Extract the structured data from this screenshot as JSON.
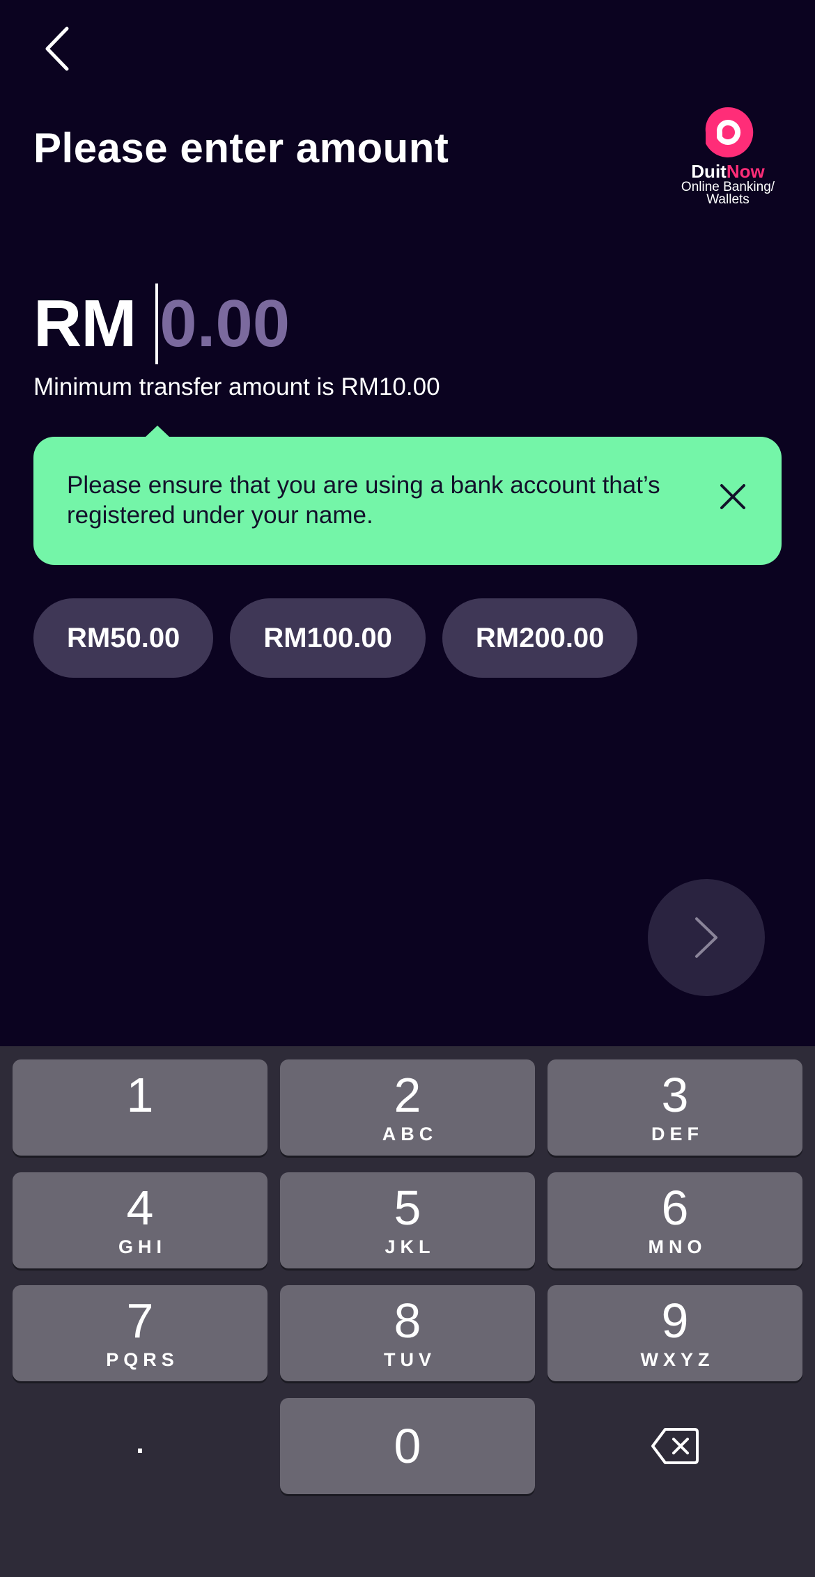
{
  "header": {
    "back_icon": "chevron-left-icon",
    "title": "Please enter amount"
  },
  "logo": {
    "word_main": "Duit",
    "word_accent": "Now",
    "subtitle_line1": "Online Banking/",
    "subtitle_line2": "Wallets",
    "brand_color": "#ff2d78"
  },
  "amount": {
    "currency": "RM",
    "placeholder": "0.00",
    "value": "",
    "min_note": "Minimum transfer amount is RM10.00"
  },
  "notice": {
    "text": "Please ensure that you are using a bank account that’s registered under your name.",
    "close_icon": "close-icon",
    "color": "#74f5a8"
  },
  "quick_amounts": [
    "RM50.00",
    "RM100.00",
    "RM200.00"
  ],
  "next_button": {
    "icon": "chevron-right-icon"
  },
  "keypad": {
    "keys": [
      {
        "num": "1",
        "letters": ""
      },
      {
        "num": "2",
        "letters": "ABC"
      },
      {
        "num": "3",
        "letters": "DEF"
      },
      {
        "num": "4",
        "letters": "GHI"
      },
      {
        "num": "5",
        "letters": "JKL"
      },
      {
        "num": "6",
        "letters": "MNO"
      },
      {
        "num": "7",
        "letters": "PQRS"
      },
      {
        "num": "8",
        "letters": "TUV"
      },
      {
        "num": "9",
        "letters": "WXYZ"
      },
      {
        "num": ".",
        "letters": ""
      },
      {
        "num": "0",
        "letters": ""
      },
      {
        "num": "",
        "letters": ""
      }
    ],
    "delete_icon": "backspace-icon"
  },
  "colors": {
    "background": "#0b0320",
    "chip": "#3f3756",
    "placeholder": "#7b6a9e",
    "keyboard": "#2e2b38",
    "key": "#6a6772"
  }
}
